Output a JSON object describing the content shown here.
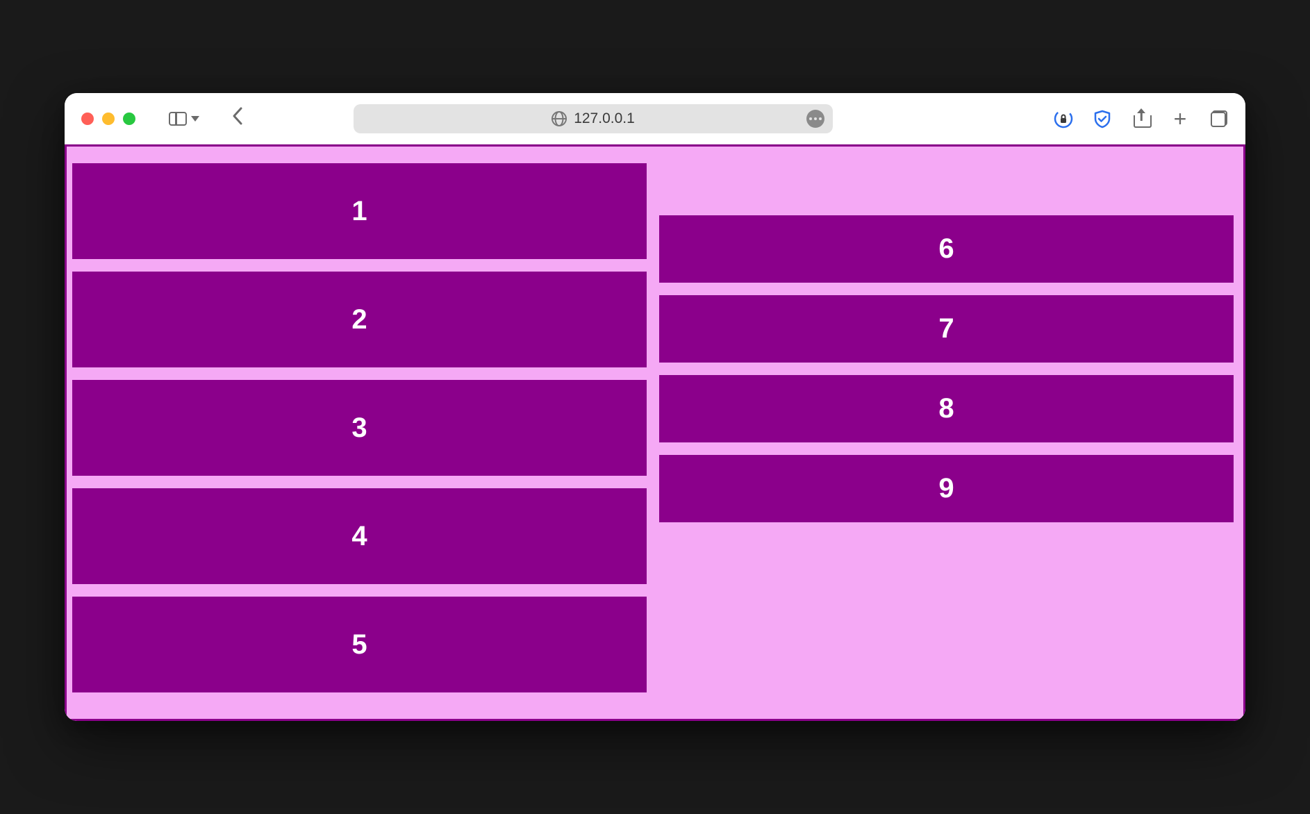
{
  "browser": {
    "address": "127.0.0.1"
  },
  "colors": {
    "containerBg": "#f5a9f5",
    "containerBorder": "#8b008b",
    "itemBg": "#8b008b",
    "itemText": "#ffffff"
  },
  "items": {
    "left": [
      "1",
      "2",
      "3",
      "4",
      "5"
    ],
    "right": [
      "6",
      "7",
      "8",
      "9"
    ]
  }
}
